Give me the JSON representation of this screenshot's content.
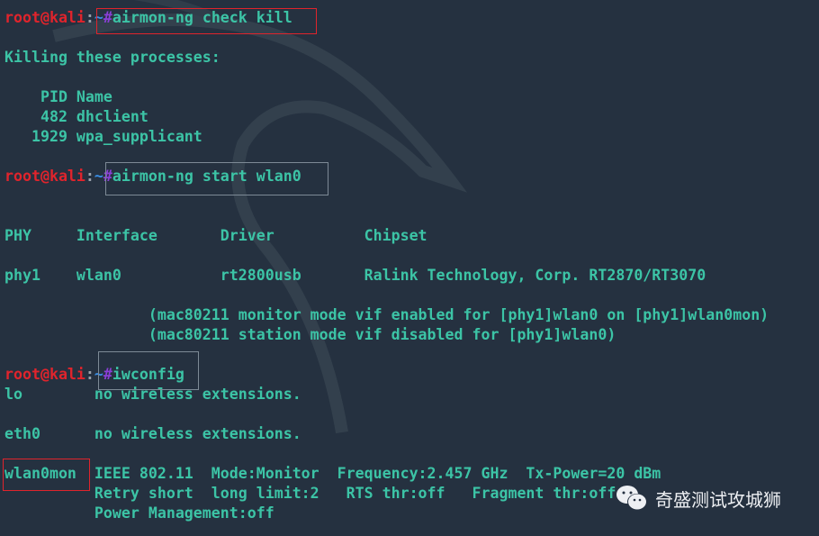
{
  "prompt": {
    "user": "root@kali",
    "sep": ":",
    "path": "~",
    "hash": "#"
  },
  "lines": [
    {
      "type": "cmd",
      "text": "airmon-ng check kill"
    },
    {
      "type": "out",
      "text": "Killing these processes:"
    },
    {
      "type": "out",
      "text": "    PID Name"
    },
    {
      "type": "out",
      "text": "    482 dhclient"
    },
    {
      "type": "out",
      "text": "   1929 wpa_supplicant"
    },
    {
      "type": "cmd",
      "text": "airmon-ng start wlan0"
    },
    {
      "type": "out",
      "text": "PHY     Interface       Driver          Chipset"
    },
    {
      "type": "out",
      "text": "phy1    wlan0           rt2800usb       Ralink Technology, Corp. RT2870/RT3070"
    },
    {
      "type": "out",
      "text": "                (mac80211 monitor mode vif enabled for [phy1]wlan0 on [phy1]wlan0mon)"
    },
    {
      "type": "out",
      "text": "                (mac80211 station mode vif disabled for [phy1]wlan0)"
    },
    {
      "type": "cmd",
      "text": "iwconfig"
    },
    {
      "type": "out",
      "text": "lo        no wireless extensions."
    },
    {
      "type": "out",
      "text": "eth0      no wireless extensions."
    },
    {
      "type": "out",
      "text": "wlan0mon  IEEE 802.11  Mode:Monitor  Frequency:2.457 GHz  Tx-Power=20 dBm"
    },
    {
      "type": "out",
      "text": "          Retry short  long limit:2   RTS thr:off   Fragment thr:off"
    },
    {
      "type": "out",
      "text": "          Power Management:off"
    }
  ],
  "watermark": {
    "icon": "wechat-icon",
    "text": "奇盛测试攻城狮"
  },
  "colors": {
    "background": "#253140",
    "text": "#3cc4a6",
    "user": "#e0242c",
    "highlight_box": "#e0242c",
    "focus_box": "#7d8a96"
  }
}
